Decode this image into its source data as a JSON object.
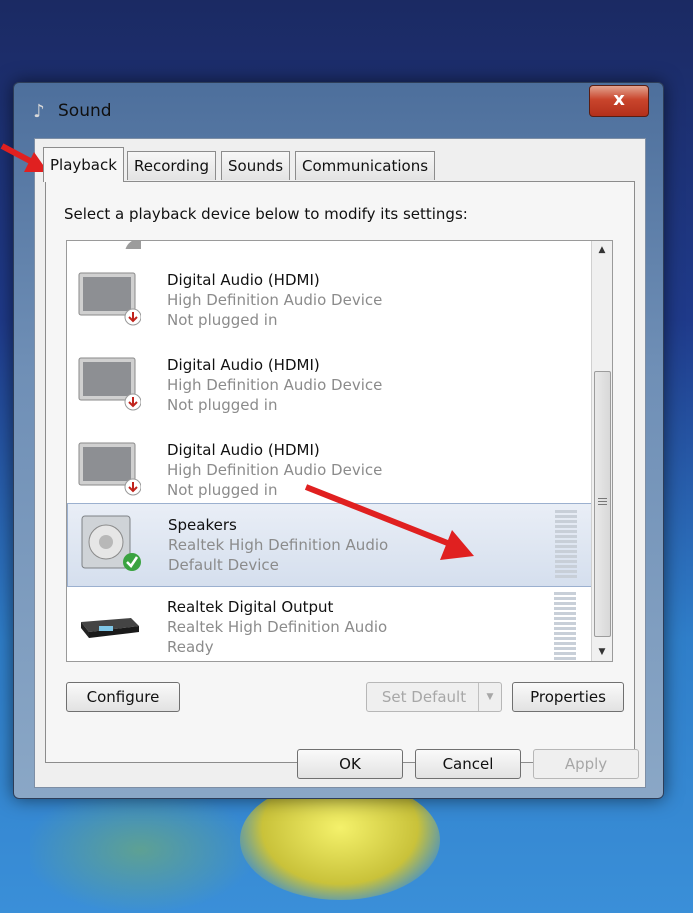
{
  "window": {
    "title": "Sound",
    "close_label": "x"
  },
  "tabs": [
    "Playback",
    "Recording",
    "Sounds",
    "Communications"
  ],
  "active_tab": "Playback",
  "instruction": "Select a playback device below to modify its settings:",
  "devices": [
    {
      "name": "Digital Audio (HDMI)",
      "description": "High Definition Audio Device",
      "status": "Not plugged in",
      "icon": "monitor-icon",
      "badge": "unplugged-badge-icon",
      "selected": false
    },
    {
      "name": "Digital Audio (HDMI)",
      "description": "High Definition Audio Device",
      "status": "Not plugged in",
      "icon": "monitor-icon",
      "badge": "unplugged-badge-icon",
      "selected": false
    },
    {
      "name": "Digital Audio (HDMI)",
      "description": "High Definition Audio Device",
      "status": "Not plugged in",
      "icon": "monitor-icon",
      "badge": "unplugged-badge-icon",
      "selected": false
    },
    {
      "name": "Speakers",
      "description": "Realtek High Definition Audio",
      "status": "Default Device",
      "icon": "speaker-icon",
      "badge": "default-check-icon",
      "selected": true
    },
    {
      "name": "Realtek Digital Output",
      "description": "Realtek High Definition Audio",
      "status": "Ready",
      "icon": "receiver-icon",
      "badge": "",
      "selected": false
    }
  ],
  "buttons": {
    "configure": "Configure",
    "set_default": "Set Default",
    "properties": "Properties",
    "ok": "OK",
    "cancel": "Cancel",
    "apply": "Apply"
  },
  "colors": {
    "annotation_arrow": "#e02020",
    "window_frame": "#6f8fb6",
    "close_button": "#c9452c"
  }
}
